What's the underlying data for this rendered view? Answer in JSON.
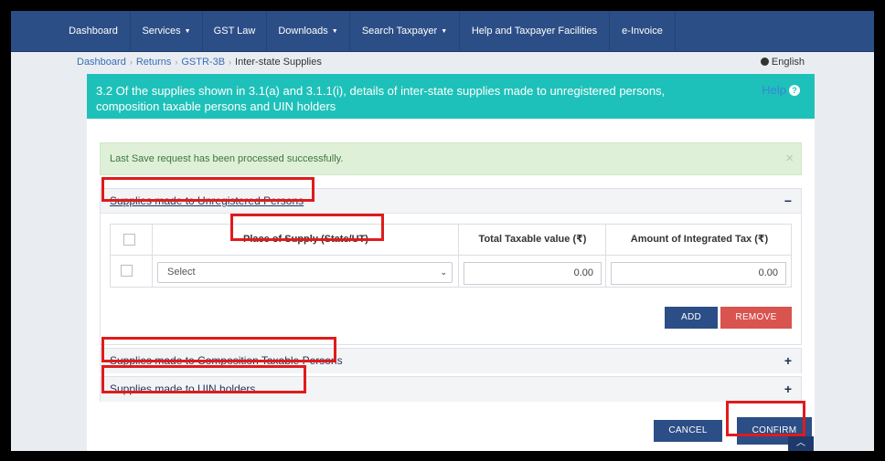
{
  "nav": {
    "items": [
      {
        "label": "Dashboard",
        "dropdown": false
      },
      {
        "label": "Services",
        "dropdown": true
      },
      {
        "label": "GST Law",
        "dropdown": false
      },
      {
        "label": "Downloads",
        "dropdown": true
      },
      {
        "label": "Search Taxpayer",
        "dropdown": true
      },
      {
        "label": "Help and Taxpayer Facilities",
        "dropdown": false
      },
      {
        "label": "e-Invoice",
        "dropdown": false
      }
    ]
  },
  "breadcrumb": {
    "items": [
      "Dashboard",
      "Returns",
      "GSTR-3B"
    ],
    "current": "Inter-state Supplies"
  },
  "language": {
    "label": "English",
    "icon": "globe-icon"
  },
  "card": {
    "title": "3.2 Of the supplies shown in 3.1(a) and 3.1.1(i), details of inter-state supplies made to unregistered persons, composition taxable persons and UIN holders",
    "help_label": "Help",
    "help_icon": "?"
  },
  "alert": {
    "message": "Last Save request has been processed successfully.",
    "close": "×"
  },
  "sections": [
    {
      "title": "Supplies made to Unregistered Persons",
      "sign": "−",
      "expanded": true
    },
    {
      "title": "Supplies made to Composition Taxable Persons",
      "sign": "+",
      "expanded": false
    },
    {
      "title": "Supplies made to UIN holders",
      "sign": "+",
      "expanded": false
    }
  ],
  "table": {
    "headers": [
      "Place of Supply (State/UT)",
      "Total Taxable value (₹)",
      "Amount of Integrated Tax (₹)"
    ],
    "row": {
      "place_of_supply": "Select",
      "taxable_value": "0.00",
      "integrated_tax": "0.00"
    }
  },
  "buttons": {
    "add": "ADD",
    "remove": "REMOVE",
    "cancel": "CANCEL",
    "confirm": "CONFIRM"
  },
  "scroll_top": "︿",
  "colors": {
    "navbar": "#2c4e86",
    "header": "#1ec1b9",
    "alert_bg": "#dff0d8",
    "highlight": "#e01b1b",
    "remove": "#d9534f"
  }
}
